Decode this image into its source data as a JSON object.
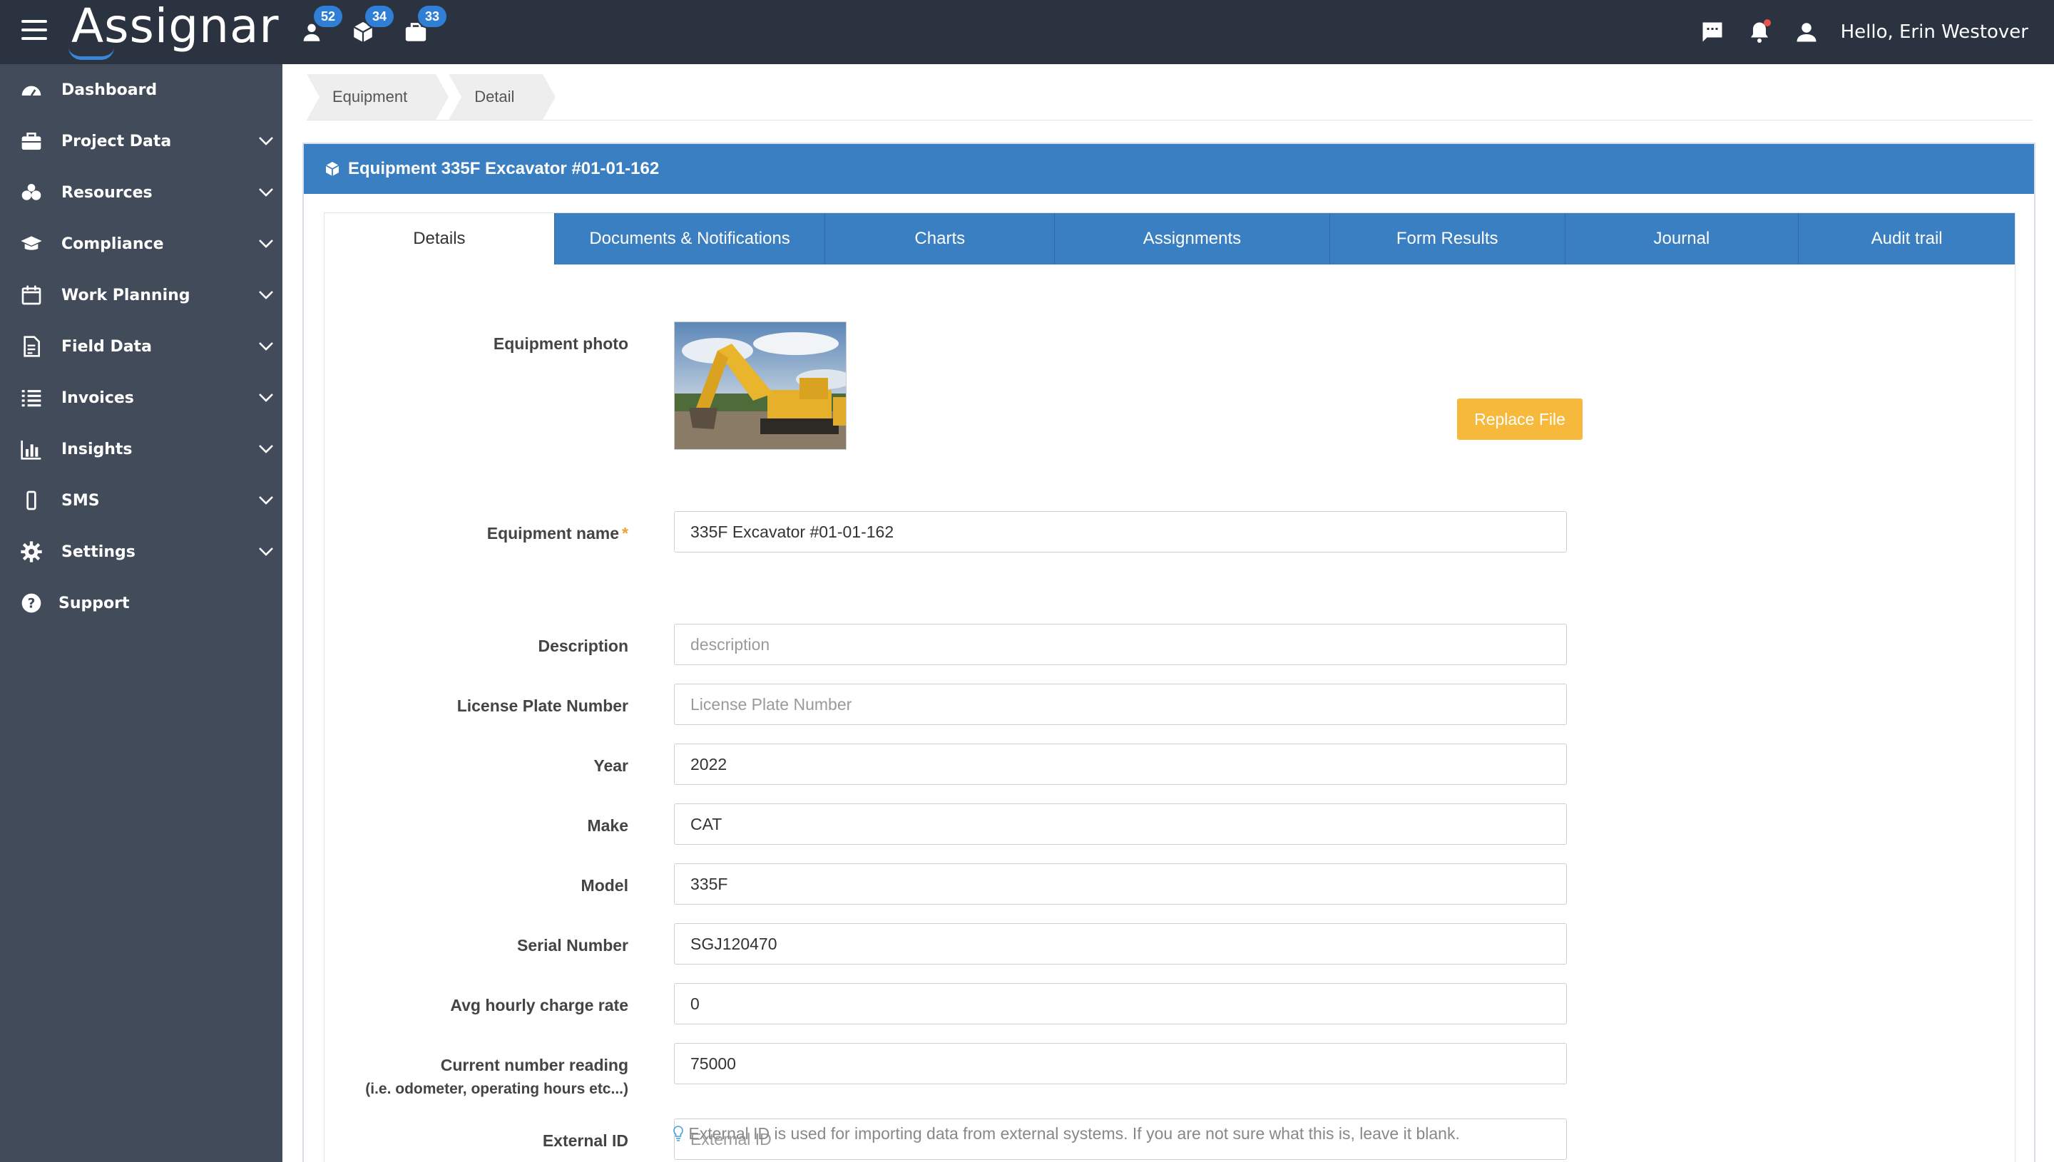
{
  "header": {
    "logo_text": "Assignar",
    "badges": {
      "people": "52",
      "equipment": "34",
      "projects": "33"
    },
    "greeting": "Hello, Erin Westover",
    "icons": [
      "menu-icon",
      "person-icon",
      "cube-icon",
      "briefcase-icon",
      "chat-icon",
      "bell-icon",
      "user-icon"
    ]
  },
  "sidebar": {
    "items": [
      {
        "label": "Dashboard",
        "icon": "dashboard-icon",
        "expandable": false
      },
      {
        "label": "Project Data",
        "icon": "briefcase-icon",
        "expandable": true
      },
      {
        "label": "Resources",
        "icon": "resources-icon",
        "expandable": true
      },
      {
        "label": "Compliance",
        "icon": "graduation-cap-icon",
        "expandable": true
      },
      {
        "label": "Work Planning",
        "icon": "calendar-icon",
        "expandable": true
      },
      {
        "label": "Field Data",
        "icon": "document-icon",
        "expandable": true
      },
      {
        "label": "Invoices",
        "icon": "list-icon",
        "expandable": true
      },
      {
        "label": "Insights",
        "icon": "bar-chart-icon",
        "expandable": true
      },
      {
        "label": "SMS",
        "icon": "mobile-icon",
        "expandable": true
      },
      {
        "label": "Settings",
        "icon": "gear-icon",
        "expandable": true
      },
      {
        "label": "Support",
        "icon": "question-icon",
        "expandable": false
      }
    ]
  },
  "breadcrumb": [
    "Equipment",
    "Detail"
  ],
  "panel": {
    "title": "Equipment 335F Excavator #01-01-162",
    "tabs": [
      "Details",
      "Documents & Notifications",
      "Charts",
      "Assignments",
      "Form Results",
      "Journal",
      "Audit trail"
    ],
    "active_tab": "Details"
  },
  "form": {
    "photo_label": "Equipment photo",
    "replace_button": "Replace File",
    "fields": {
      "name": {
        "label": "Equipment name",
        "required_mark": "*",
        "value": "335F Excavator #01-01-162",
        "placeholder": ""
      },
      "description": {
        "label": "Description",
        "value": "",
        "placeholder": "description"
      },
      "license": {
        "label": "License Plate Number",
        "value": "",
        "placeholder": "License Plate Number"
      },
      "year": {
        "label": "Year",
        "value": "2022",
        "placeholder": ""
      },
      "make": {
        "label": "Make",
        "value": "CAT",
        "placeholder": ""
      },
      "model": {
        "label": "Model",
        "value": "335F",
        "placeholder": ""
      },
      "serial": {
        "label": "Serial Number",
        "value": "SGJ120470",
        "placeholder": ""
      },
      "rate": {
        "label": "Avg hourly charge rate",
        "value": "0",
        "placeholder": ""
      },
      "reading": {
        "label": "Current number reading",
        "sublabel": "(i.e. odometer, operating hours etc...)",
        "value": "75000",
        "placeholder": ""
      },
      "external": {
        "label": "External ID",
        "value": "",
        "placeholder": "External ID"
      }
    },
    "external_help": "External ID is used for importing data from external systems. If you are not sure what this is, leave it blank."
  },
  "colors": {
    "topbar": "#2b3340",
    "sidebar": "#414b5a",
    "accent": "#3a7fc1",
    "badge": "#2f7fd6",
    "button": "#f6b93b"
  }
}
